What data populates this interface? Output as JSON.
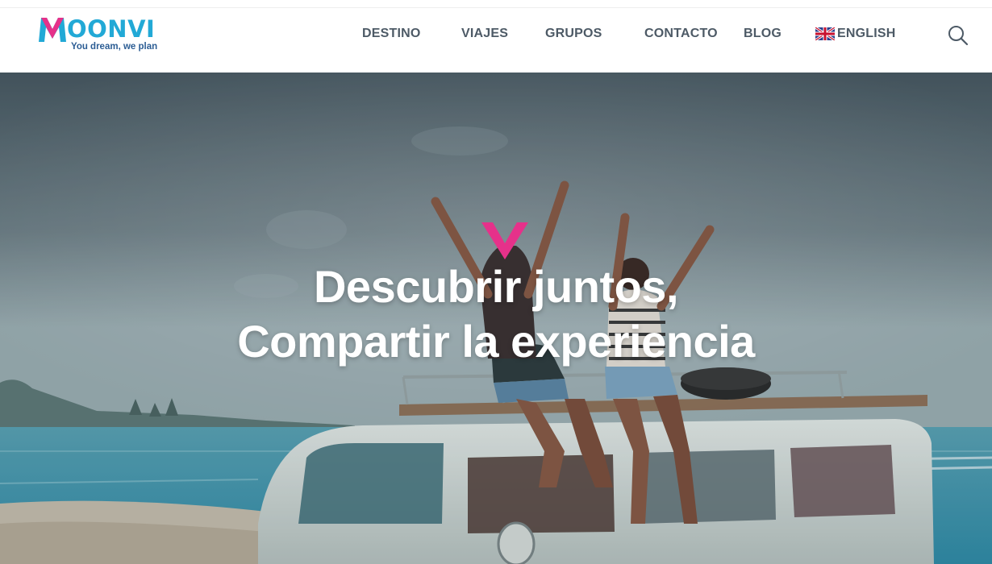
{
  "header": {
    "logo": {
      "first_letter": "M",
      "wordmark_rest": "OONVI",
      "tagline": "You dream, we plan"
    },
    "nav": {
      "destino": "DESTINO",
      "viajes": "VIAJES",
      "grupos": "GRUPOS",
      "contacto": "CONTACTO",
      "blog": "BLOG",
      "language": "ENGLISH"
    },
    "icons": {
      "flag": "uk-flag-icon",
      "search": "search-icon"
    }
  },
  "hero": {
    "title_line1": "Descubrir juntos,",
    "title_line2": "Compartir la experiencia",
    "mark_icon": "moonvi-v-mark-icon"
  },
  "colors": {
    "brand_pink": "#e6318a",
    "brand_cyan": "#22a9d6",
    "tagline_blue": "#2c5d94",
    "nav_text": "#4d5a66"
  }
}
